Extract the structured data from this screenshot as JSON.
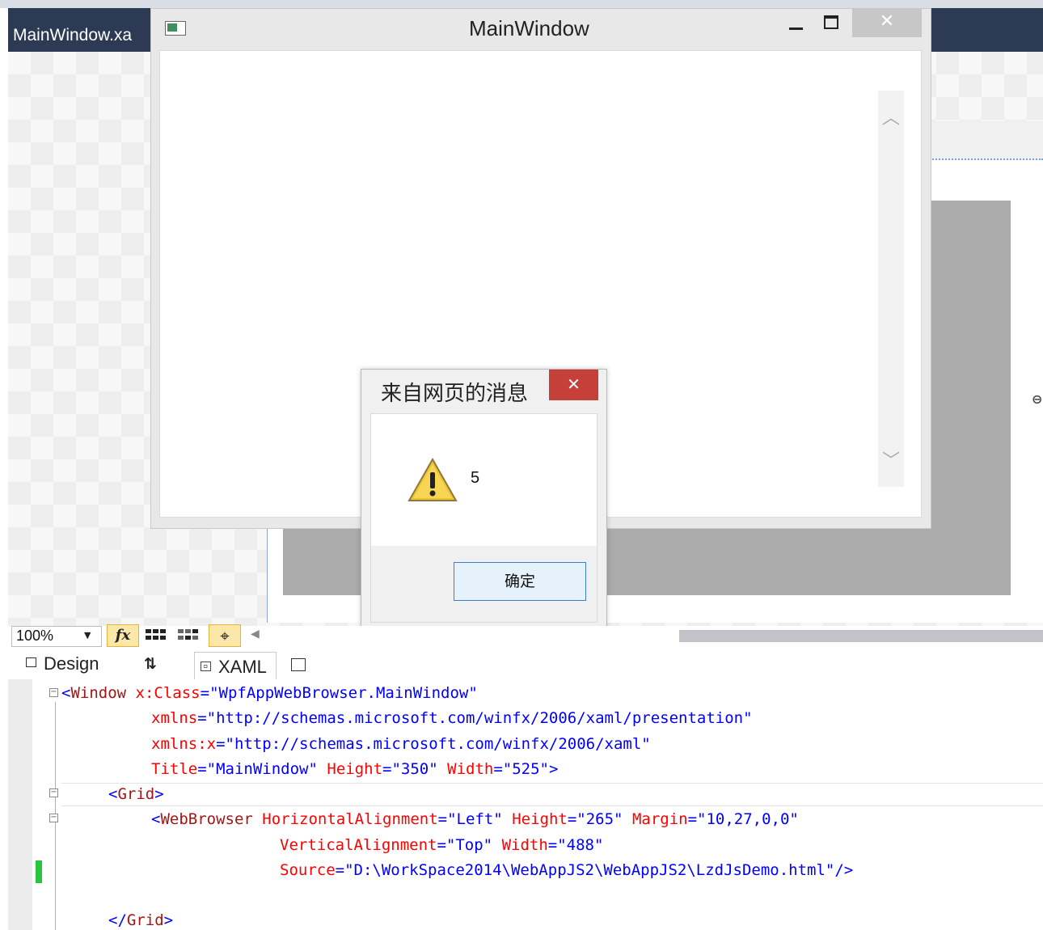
{
  "ide": {
    "document_tab": "MainWindow.xa"
  },
  "main_window": {
    "title": "MainWindow",
    "close_glyph": "✕",
    "scroll_up_glyph": "︿",
    "scroll_down_glyph": "﹀"
  },
  "alert": {
    "title": "来自网页的消息",
    "close_glyph": "✕",
    "icon": "warning-icon",
    "message": "5",
    "ok_label": "确定"
  },
  "designer_toolbar": {
    "zoom_value": "100%",
    "fx_label": "fx",
    "snapline_glyph": "⌖",
    "scroll_left_glyph": "◀"
  },
  "view_tabs": {
    "design_label": "Design",
    "swap_glyph": "⇅",
    "xaml_label": "XAML"
  },
  "code": {
    "l1_open": "<",
    "l1_tag": "Window",
    "l1_attr": "x:Class",
    "l1_value": "\"WpfAppWebBrowser.MainWindow\"",
    "l2_attr": "xmlns",
    "l2_value": "\"http://schemas.microsoft.com/winfx/2006/xaml/presentation\"",
    "l3_attr": "xmlns:x",
    "l3_value": "\"http://schemas.microsoft.com/winfx/2006/xaml\"",
    "l4_attr1": "Title",
    "l4_value1": "\"MainWindow\"",
    "l4_attr2": "Height",
    "l4_value2": "\"350\"",
    "l4_attr3": "Width",
    "l4_value3": "\"525\"",
    "l4_close": ">",
    "l5_tag": "Grid",
    "l6_tag": "WebBrowser",
    "l6_attr1": "HorizontalAlignment",
    "l6_value1": "\"Left\"",
    "l6_attr2": "Height",
    "l6_value2": "\"265\"",
    "l6_attr3": "Margin",
    "l6_value3": "\"10,27,0,0\"",
    "l7_attr1": "VerticalAlignment",
    "l7_value1": "\"Top\"",
    "l7_attr2": "Width",
    "l7_value2": "\"488\"",
    "l8_attr": "Source",
    "l8_value": "\"D:\\WorkSpace2014\\WebAppJS2\\WebAppJS2\\LzdJsDemo.html\"",
    "l8_close": "/>",
    "l10_tag": "Grid"
  }
}
